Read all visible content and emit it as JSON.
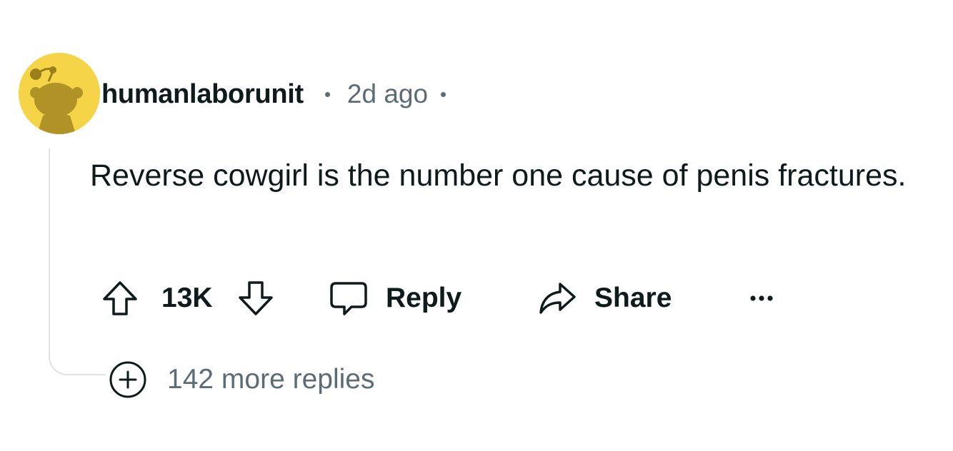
{
  "comment": {
    "username": "humanlaborunit",
    "timestamp": "2d ago",
    "body": "Reverse cowgirl is the number one cause of penis fractures.",
    "score": "13K",
    "reply_label": "Reply",
    "share_label": "Share",
    "more_replies_label": "142 more replies"
  },
  "icons": {
    "avatar": "snoo-avatar",
    "upvote": "arrow-up-icon",
    "downvote": "arrow-down-icon",
    "reply": "speech-bubble-icon",
    "share": "share-arrow-icon",
    "more": "ellipsis-icon",
    "expand": "plus-circle-icon"
  },
  "colors": {
    "avatar_bg": "#f5d547",
    "text_primary": "#0f1a1c",
    "text_secondary": "#5c6c74",
    "thread_line": "#dfe3e6"
  }
}
